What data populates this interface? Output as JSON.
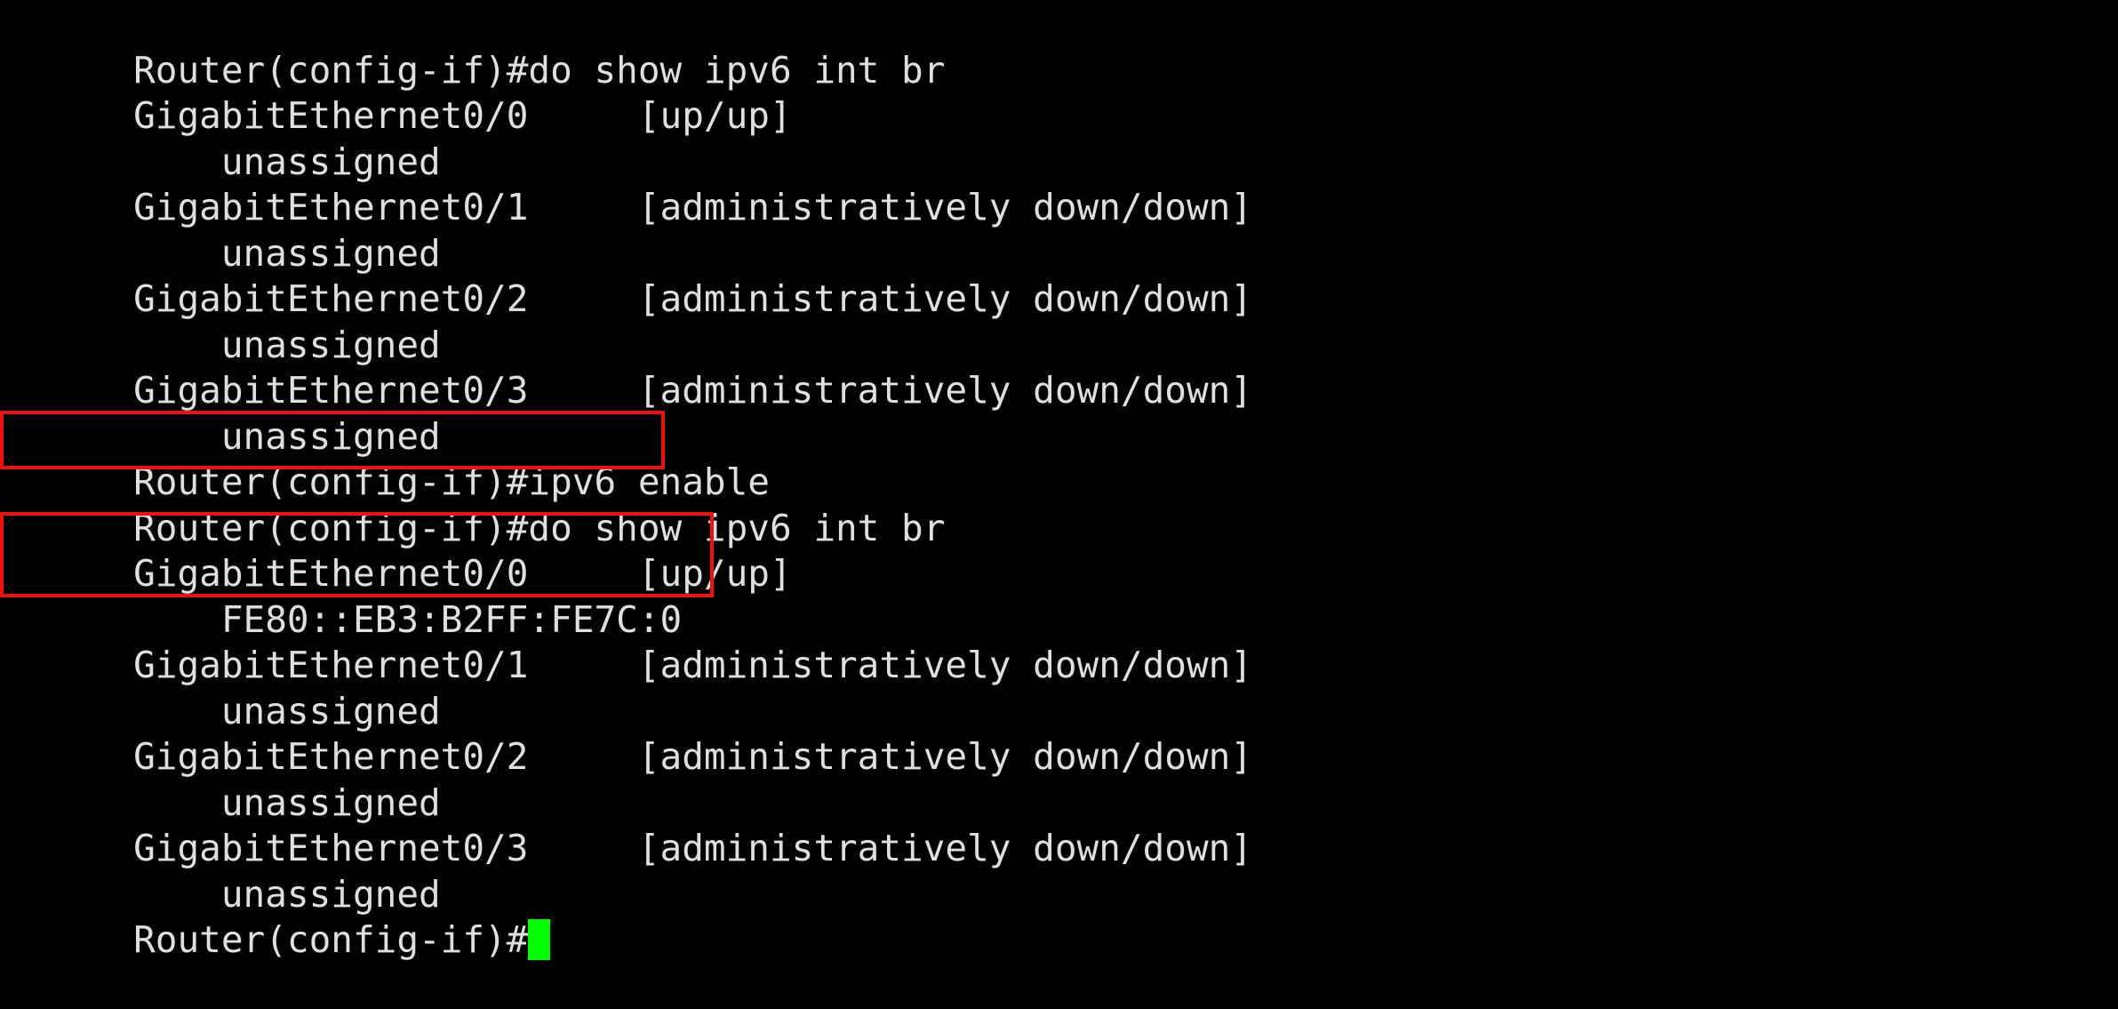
{
  "terminal": {
    "background_color": "#000000",
    "text_color": "#dfdfdf",
    "cursor_color": "#00ff00",
    "highlight_color": "#ee1111",
    "prompt": "Router(config-if)#",
    "lines": [
      {
        "id": "l01",
        "text": "Router(config-if)#do show ipv6 int br",
        "kind": "command"
      },
      {
        "id": "l02",
        "text": "GigabitEthernet0/0     [up/up]",
        "kind": "output"
      },
      {
        "id": "l03",
        "text": "    unassigned",
        "kind": "output"
      },
      {
        "id": "l04",
        "text": "GigabitEthernet0/1     [administratively down/down]",
        "kind": "output"
      },
      {
        "id": "l05",
        "text": "    unassigned",
        "kind": "output"
      },
      {
        "id": "l06",
        "text": "GigabitEthernet0/2     [administratively down/down]",
        "kind": "output"
      },
      {
        "id": "l07",
        "text": "    unassigned",
        "kind": "output"
      },
      {
        "id": "l08",
        "text": "GigabitEthernet0/3     [administratively down/down]",
        "kind": "output"
      },
      {
        "id": "l09",
        "text": "    unassigned",
        "kind": "output"
      },
      {
        "id": "l10",
        "text": "Router(config-if)#ipv6 enable",
        "kind": "command"
      },
      {
        "id": "l11",
        "text": "Router(config-if)#do show ipv6 int br",
        "kind": "command"
      },
      {
        "id": "l12",
        "text": "GigabitEthernet0/0     [up/up]",
        "kind": "output"
      },
      {
        "id": "l13",
        "text": "    FE80::EB3:B2FF:FE7C:0",
        "kind": "output"
      },
      {
        "id": "l14",
        "text": "GigabitEthernet0/1     [administratively down/down]",
        "kind": "output"
      },
      {
        "id": "l15",
        "text": "    unassigned",
        "kind": "output"
      },
      {
        "id": "l16",
        "text": "GigabitEthernet0/2     [administratively down/down]",
        "kind": "output"
      },
      {
        "id": "l17",
        "text": "    unassigned",
        "kind": "output"
      },
      {
        "id": "l18",
        "text": "GigabitEthernet0/3     [administratively down/down]",
        "kind": "output"
      },
      {
        "id": "l19",
        "text": "    unassigned",
        "kind": "output"
      },
      {
        "id": "l20",
        "text": "Router(config-if)#",
        "kind": "prompt"
      }
    ],
    "highlights": [
      {
        "id": "hl1",
        "target_line": "l10",
        "label": "ipv6-enable-command-highlight"
      },
      {
        "id": "hl2",
        "target_lines": "l12,l13",
        "label": "link-local-address-highlight"
      }
    ]
  }
}
